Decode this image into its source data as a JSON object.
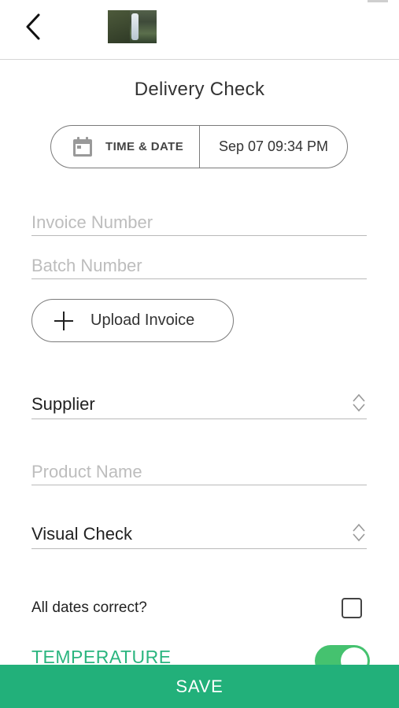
{
  "page": {
    "title": "Delivery Check"
  },
  "datetime": {
    "label": "TIME & DATE",
    "value": "Sep 07 09:34 PM"
  },
  "fields": {
    "invoice_number": {
      "placeholder": "Invoice Number",
      "value": ""
    },
    "batch_number": {
      "placeholder": "Batch Number",
      "value": ""
    },
    "product_name": {
      "placeholder": "Product Name",
      "value": ""
    }
  },
  "upload": {
    "label": "Upload Invoice"
  },
  "selects": {
    "supplier": {
      "value": "Supplier"
    },
    "visual_check": {
      "value": "Visual Check"
    }
  },
  "dates_check": {
    "label": "All dates correct?",
    "checked": false
  },
  "temperature": {
    "label": "TEMPERATURE",
    "enabled": true
  },
  "footer": {
    "save_label": "SAVE"
  },
  "colors": {
    "accent": "#22b07a",
    "toggle": "#45c26f",
    "temperature_text": "#2bb57f"
  },
  "icons": [
    "back-chevron-icon",
    "calendar-icon",
    "plus-icon",
    "sort-arrows-icon"
  ]
}
